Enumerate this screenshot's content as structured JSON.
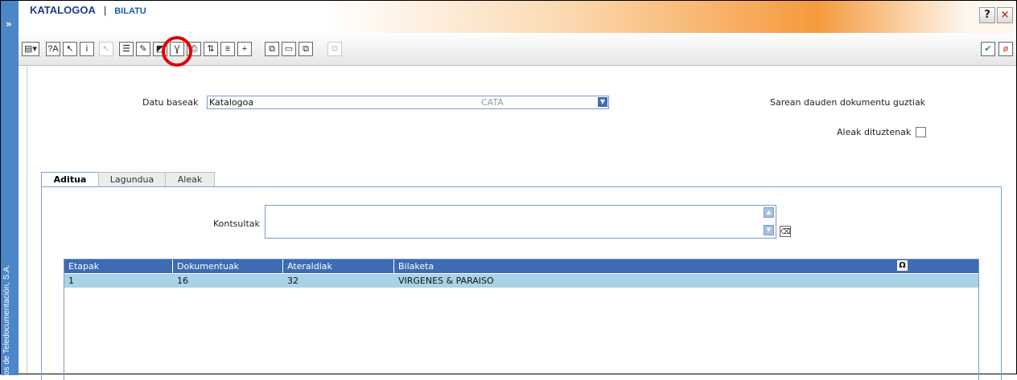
{
  "sidebar": {
    "expand_label": "»",
    "vertical_text": "os de Teledocumentación, S.A."
  },
  "header": {
    "title": "KATALOGOA",
    "separator": "|",
    "subtitle": "BILATU",
    "help_label": "?",
    "close_label": "×"
  },
  "toolbar": {
    "buttons": [
      "▤▾",
      "?A",
      "↖",
      "i",
      "↖",
      "☰",
      "✎",
      "◩",
      "Ɣ",
      "⎙",
      "⇅",
      "≡",
      "+",
      "⧉",
      "▭",
      "⧉",
      "⧉"
    ],
    "accept_label": "✔",
    "cancel_label": "ø"
  },
  "form": {
    "datu_label": "Datu baseak",
    "datu_value": "Katalogoa",
    "datu_code": "CATA",
    "dropdown_arrow": "▼",
    "sarean_label": "Sarean dauden dokumentu guztiak",
    "aleak_label": "Aleak dituztenak"
  },
  "tabs": [
    {
      "label": "Aditua"
    },
    {
      "label": "Lagundua"
    },
    {
      "label": "Aleak"
    }
  ],
  "query": {
    "label": "Kontsultak",
    "value": "",
    "up": "▲",
    "down": "▼",
    "clear_icon": "⌫"
  },
  "grid": {
    "headers": [
      "Etapak",
      "Dokumentuak",
      "Ateraldiak",
      "Bilaketa"
    ],
    "header_icon": "Ω",
    "rows": [
      {
        "etapak": "1",
        "dokumentuak": "16",
        "ateraldiak": "32",
        "bilaketa": "VIRGENES & PARAISO"
      }
    ]
  },
  "colors": {
    "accent": "#3d6bb4",
    "row_highlight": "#a8d3e6",
    "annotation": "#e00000",
    "title": "#1e3f80"
  }
}
